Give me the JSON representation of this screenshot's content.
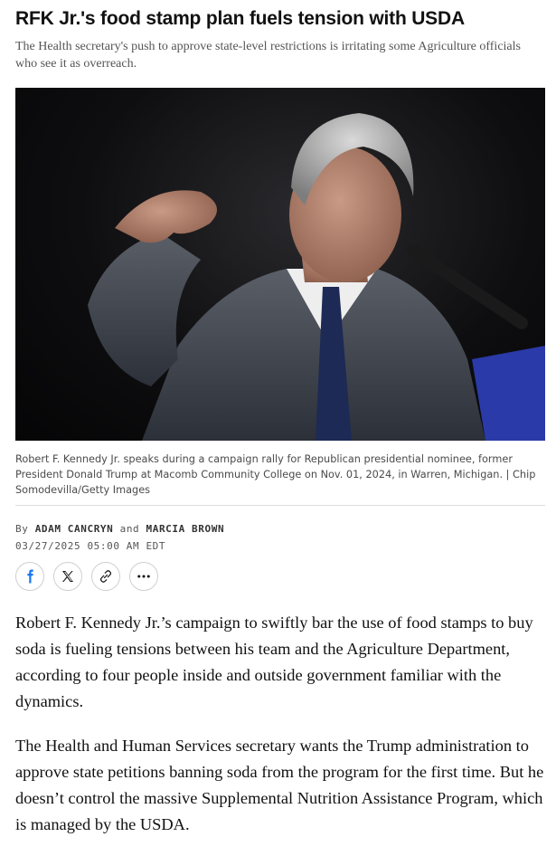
{
  "article": {
    "headline": "RFK Jr.'s food stamp plan fuels tension with USDA",
    "dek": "The Health secretary's push to approve state-level restrictions is irritating some Agriculture officials who see it as overreach.",
    "image": {
      "caption": "Robert F. Kennedy Jr. speaks during a campaign rally for Republican presidential nominee, former President Donald Trump at Macomb Community College on Nov. 01, 2024, in Warren, Michigan. | Chip Somodevilla/Getty Images"
    },
    "byline": {
      "prefix": "By",
      "author1": "ADAM CANCRYN",
      "conjunction": "and",
      "author2": "MARCIA BROWN"
    },
    "date": "03/27/2025 05:00 AM EDT",
    "share": {
      "icons": [
        "facebook-icon",
        "x-icon",
        "link-icon",
        "more-icon"
      ]
    },
    "paragraphs": [
      "Robert F. Kennedy Jr.’s campaign to swiftly bar the use of food stamps to buy soda is fueling tensions between his team and the Agriculture Department, according to four people inside and outside government familiar with the dynamics.",
      "The Health and Human Services secretary wants the Trump administration to approve state petitions banning soda from the program for the first time. But he doesn’t control the massive Supplemental Nutrition Assistance Program, which is managed by the USDA."
    ]
  },
  "colors": {
    "facebook": "#1877f2",
    "text": "#111111",
    "muted": "#555555"
  }
}
